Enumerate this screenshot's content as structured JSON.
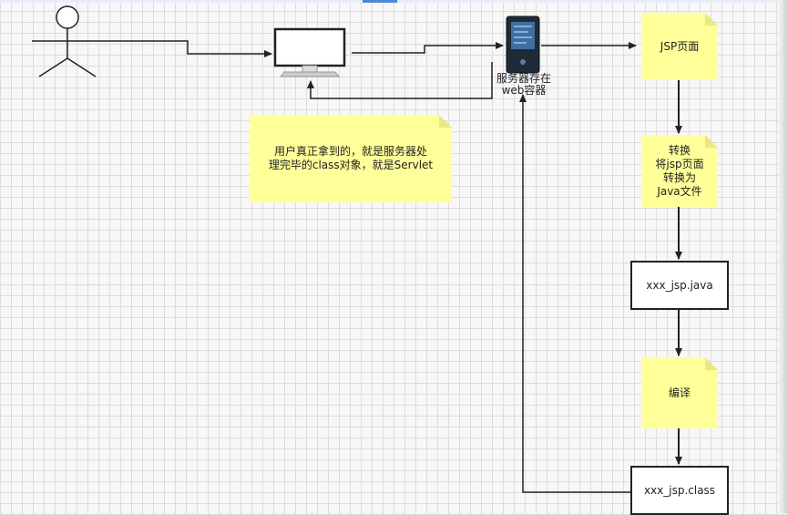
{
  "notes": {
    "jsp_page": "JSP页面",
    "servlet_note_line1": "用户真正拿到的，就是服务器处",
    "servlet_note_line2": "理完毕的class对象，就是Servlet",
    "convert_line1": "转换",
    "convert_line2": "将jsp页面",
    "convert_line3": "转换为",
    "convert_line4": "Java文件",
    "compile": "编译"
  },
  "boxes": {
    "java_file": "xxx_jsp.java",
    "class_file": "xxx_jsp.class"
  },
  "server_label": {
    "line1": "服务器存在",
    "line2": "web容器"
  },
  "colors": {
    "note_fill": "#ffff99",
    "line": "#222222",
    "server_body": "#1f2a38",
    "server_screen": "#3f6fa0"
  },
  "icons": [
    "person-icon",
    "computer-monitor-icon",
    "server-icon"
  ]
}
